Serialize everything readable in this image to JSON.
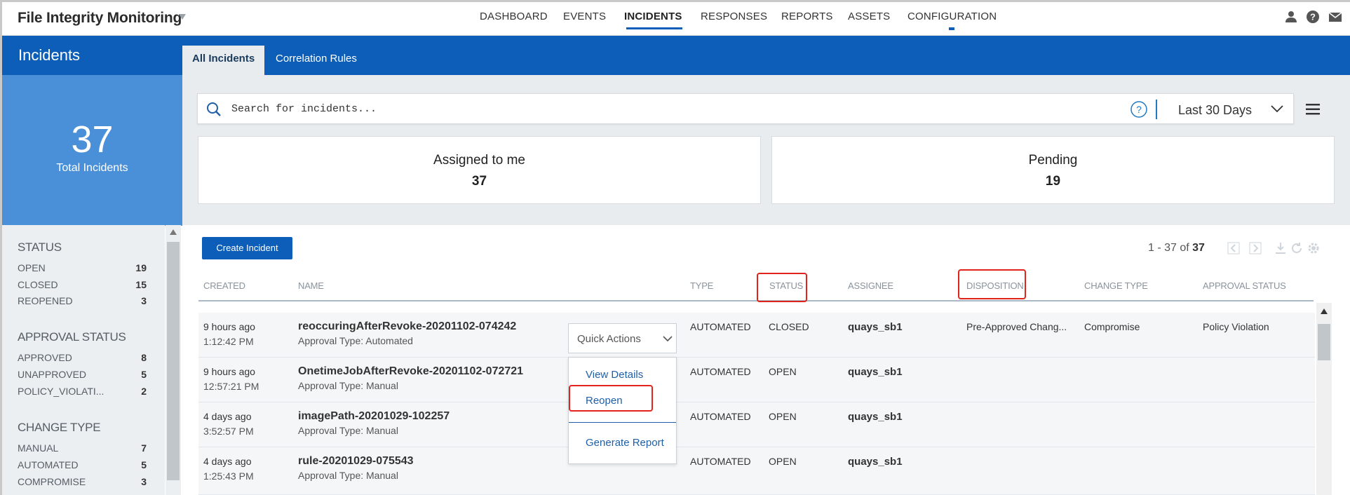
{
  "app": {
    "title": "File Integrity Monitoring"
  },
  "nav": {
    "items": [
      {
        "label": "DASHBOARD"
      },
      {
        "label": "EVENTS"
      },
      {
        "label": "INCIDENTS"
      },
      {
        "label": "RESPONSES"
      },
      {
        "label": "REPORTS"
      },
      {
        "label": "ASSETS"
      },
      {
        "label": "CONFIGURATION"
      }
    ],
    "active": "INCIDENTS"
  },
  "header_icons": [
    "user-icon",
    "help-icon",
    "mail-icon"
  ],
  "page": {
    "title": "Incidents"
  },
  "tabs": [
    {
      "label": "All Incidents",
      "active": true
    },
    {
      "label": "Correlation Rules",
      "active": false
    }
  ],
  "summary": {
    "count": "37",
    "label": "Total Incidents"
  },
  "search": {
    "placeholder": "Search for incidents...",
    "date_range": "Last 30 Days"
  },
  "cards": [
    {
      "title": "Assigned to me",
      "value": "37"
    },
    {
      "title": "Pending",
      "value": "19"
    }
  ],
  "filters": {
    "status": {
      "heading": "STATUS",
      "items": [
        {
          "label": "OPEN",
          "count": "19"
        },
        {
          "label": "CLOSED",
          "count": "15"
        },
        {
          "label": "REOPENED",
          "count": "3"
        }
      ]
    },
    "approval": {
      "heading": "APPROVAL STATUS",
      "items": [
        {
          "label": "APPROVED",
          "count": "8"
        },
        {
          "label": "UNAPPROVED",
          "count": "5"
        },
        {
          "label": "POLICY_VIOLATI...",
          "count": "2"
        }
      ]
    },
    "change": {
      "heading": "CHANGE TYPE",
      "items": [
        {
          "label": "MANUAL",
          "count": "7"
        },
        {
          "label": "AUTOMATED",
          "count": "5"
        },
        {
          "label": "COMPROMISE",
          "count": "3"
        }
      ]
    }
  },
  "toolbar": {
    "create_label": "Create Incident",
    "pager_range": "1 - 37 of",
    "pager_total": "37"
  },
  "table": {
    "columns": [
      "CREATED",
      "NAME",
      "TYPE",
      "STATUS",
      "ASSIGNEE",
      "DISPOSITION",
      "CHANGE TYPE",
      "APPROVAL STATUS"
    ],
    "rows": [
      {
        "created": "9 hours ago",
        "time": "1:12:42 PM",
        "name": "reoccuringAfterRevoke-20201102-074242",
        "approval_type": "Approval Type: Automated",
        "type": "AUTOMATED",
        "status": "CLOSED",
        "assignee": "quays_sb1",
        "disposition": "Pre-Approved Chang...",
        "change_type": "Compromise",
        "approval_status": "Policy Violation"
      },
      {
        "created": "9 hours ago",
        "time": "12:57:21 PM",
        "name": "OnetimeJobAfterRevoke-20201102-072721",
        "approval_type": "Approval Type: Manual",
        "type": "AUTOMATED",
        "status": "OPEN",
        "assignee": "quays_sb1",
        "disposition": "",
        "change_type": "",
        "approval_status": ""
      },
      {
        "created": "4 days ago",
        "time": "3:52:57 PM",
        "name": "imagePath-20201029-102257",
        "approval_type": "Approval Type: Manual",
        "type": "AUTOMATED",
        "status": "OPEN",
        "assignee": "quays_sb1",
        "disposition": "",
        "change_type": "",
        "approval_status": ""
      },
      {
        "created": "4 days ago",
        "time": "1:25:43 PM",
        "name": "rule-20201029-075543",
        "approval_type": "Approval Type: Manual",
        "type": "AUTOMATED",
        "status": "OPEN",
        "assignee": "quays_sb1",
        "disposition": "",
        "change_type": "",
        "approval_status": ""
      }
    ]
  },
  "quick_actions": {
    "label": "Quick Actions",
    "items": [
      {
        "label": "View Details"
      },
      {
        "label": "Reopen"
      },
      {
        "label": "Generate Report"
      }
    ]
  },
  "colors": {
    "brand_blue": "#0c5eb8",
    "summary_blue": "#4a90d9",
    "highlight_red": "#e0231b"
  }
}
